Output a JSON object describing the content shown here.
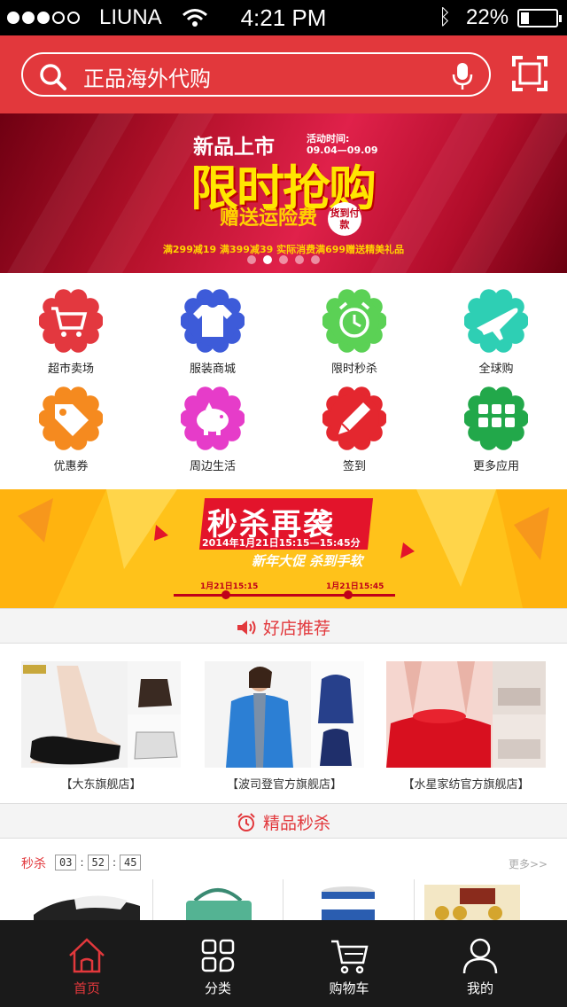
{
  "status_bar": {
    "carrier": "LIUNA",
    "time": "4:21 PM",
    "battery": "22%",
    "battery_level": 0.22,
    "signal_bars": 3,
    "signal_total": 5
  },
  "search": {
    "placeholder": "正品海外代购"
  },
  "banner": {
    "title_top": "新品上市",
    "activity_time": "活动时间:",
    "date_range": "09.04—09.09",
    "main_title": "限时抢购",
    "subtitle": "赠送运险费",
    "badge": "货到付款",
    "promo_line": "满299减19  满399减39  实际消费满699赠送精美礼品",
    "page_count": 5,
    "active_page": 2
  },
  "categories": [
    {
      "label": "超市卖场",
      "icon": "cart-icon",
      "color": "#e3383f"
    },
    {
      "label": "服装商城",
      "icon": "shirt-icon",
      "color": "#3d5bd9"
    },
    {
      "label": "限时秒杀",
      "icon": "alarm-clock-icon",
      "color": "#5bd155"
    },
    {
      "label": "全球购",
      "icon": "airplane-icon",
      "color": "#2ecfb4"
    },
    {
      "label": "优惠券",
      "icon": "tag-icon",
      "color": "#f58a1f"
    },
    {
      "label": "周边生活",
      "icon": "piggy-bank-icon",
      "color": "#e63cc9"
    },
    {
      "label": "签到",
      "icon": "pencil-icon",
      "color": "#e4272f"
    },
    {
      "label": "更多应用",
      "icon": "apps-grid-icon",
      "color": "#22a84a"
    }
  ],
  "flash_banner": {
    "title": "秒杀再袭",
    "time_range": "2014年1月21日15:15—15:45分",
    "slogan": "新年大促  杀到手软",
    "start_label": "1月21日15:15",
    "end_label": "1月21日15:45"
  },
  "section_shops": {
    "title": "好店推荐"
  },
  "shops": [
    {
      "name": "【大东旗舰店】"
    },
    {
      "name": "【波司登官方旗舰店】"
    },
    {
      "name": "【水星家纺官方旗舰店】"
    }
  ],
  "section_flash": {
    "title": "精品秒杀"
  },
  "flash_goods": {
    "label": "秒杀",
    "hours": "03",
    "minutes": "52",
    "seconds": "45",
    "separator": ":",
    "more": "更多>>"
  },
  "tabs": [
    {
      "label": "首页",
      "icon": "home-icon",
      "active": true
    },
    {
      "label": "分类",
      "icon": "category-icon",
      "active": false
    },
    {
      "label": "购物车",
      "icon": "shopping-cart-icon",
      "active": false
    },
    {
      "label": "我的",
      "icon": "user-icon",
      "active": false
    }
  ],
  "colors": {
    "brand_red": "#e2383c",
    "tabbar_bg": "#1a1a1a"
  }
}
